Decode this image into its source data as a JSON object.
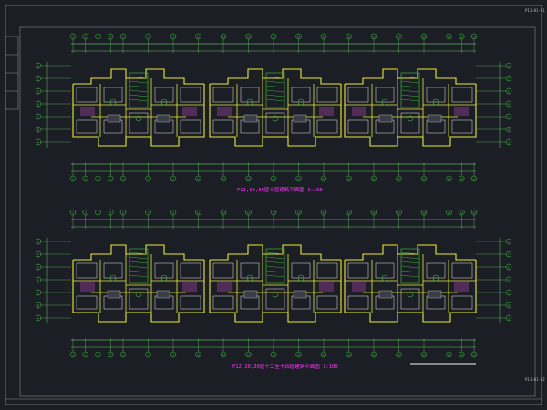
{
  "drawing": {
    "plans": [
      {
        "title": "P11,20,30层十层建筑平面图 1:100",
        "grid_top": [
          "1",
          "2",
          "3",
          "4",
          "5",
          "6",
          "7",
          "8",
          "9",
          "10",
          "11",
          "12",
          "13",
          "14",
          "15",
          "16",
          "17",
          "18",
          "19",
          "20",
          "21",
          "22",
          "23",
          "24",
          "25",
          "26",
          "27",
          "28",
          "29",
          "30",
          "31",
          "32",
          "33"
        ],
        "grid_side": [
          "G",
          "F",
          "E",
          "D",
          "C",
          "B",
          "A"
        ]
      },
      {
        "title": "P12,20,30层十二至十四层建筑平面图 1:100",
        "grid_top": [
          "1",
          "2",
          "3",
          "4",
          "5",
          "6",
          "7",
          "8",
          "9",
          "10",
          "11",
          "12",
          "13",
          "14",
          "15",
          "16",
          "17",
          "18",
          "19",
          "20",
          "21",
          "22",
          "23",
          "24",
          "25",
          "26",
          "27",
          "28",
          "29",
          "30",
          "31",
          "32",
          "33"
        ],
        "grid_side": [
          "G",
          "F",
          "E",
          "D",
          "C",
          "B",
          "A"
        ]
      }
    ],
    "corner_tags": {
      "top_right": "P11-01-01",
      "bottom_right": "P11-01-02"
    },
    "colors": {
      "background": "#1b1e24",
      "walls": "#e8e83a",
      "dimensions": "#7cf07c",
      "grid_axes": "#48d848",
      "rooms": "#ffffff",
      "stairs": "#cf4fcf",
      "plants": "#3ab03a",
      "titles": "#ff3cff",
      "frame": "#9a9a9a"
    }
  }
}
